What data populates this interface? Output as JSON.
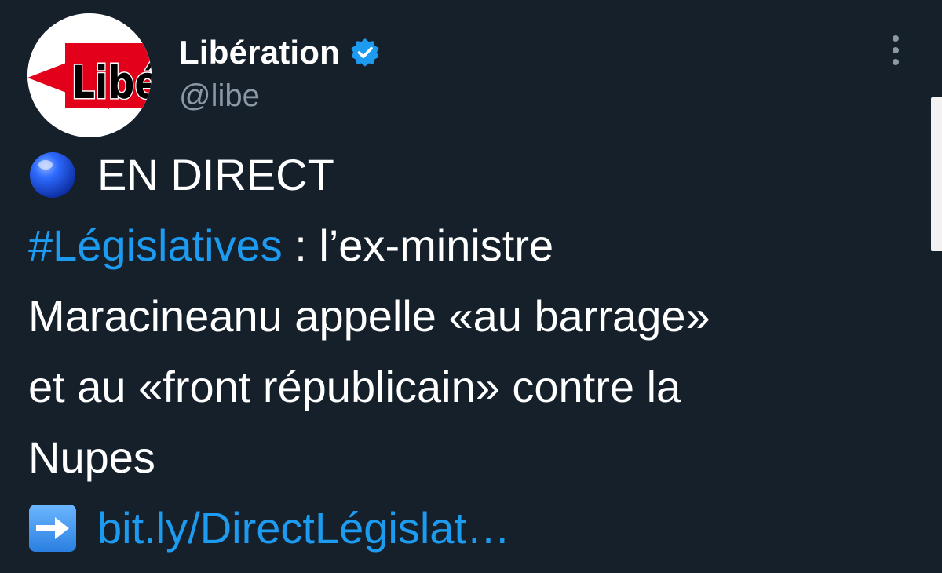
{
  "tweet": {
    "author": {
      "avatar_text": "Libé",
      "display_name": "Libération",
      "handle": "@libe",
      "verified": true
    },
    "more_icon": "more-vertical-icon",
    "body": {
      "emoji_live": "blue-circle-emoji",
      "live_label": "EN DIRECT",
      "hashtag": "#Législatives",
      "line2_rest": " : l’ex-ministre",
      "line3": "Maracineanu appelle «au barrage»",
      "line4": "et au «front républicain» contre la",
      "line5": "Nupes",
      "emoji_arrow": "right-arrow-emoji",
      "link": "bit.ly/DirectLégislat…"
    }
  },
  "colors": {
    "background": "#15202b",
    "text": "#ffffff",
    "secondary": "#8b98a5",
    "link": "#1d9bf0",
    "verified_badge": "#1d9bf0",
    "logo_red": "#e2001a"
  }
}
